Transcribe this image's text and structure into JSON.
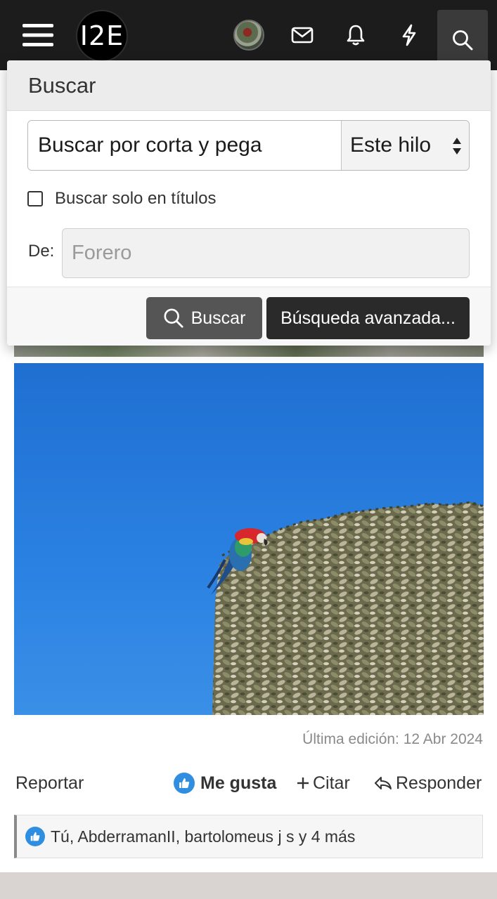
{
  "header": {
    "logo_text": "I2E",
    "icons": [
      "menu-icon",
      "avatar",
      "mail-icon",
      "bell-icon",
      "bolt-icon",
      "search-icon"
    ]
  },
  "search_panel": {
    "title": "Buscar",
    "query_value": "Buscar por corta y pega",
    "scope_selected": "Este hilo",
    "titles_only_label": "Buscar solo en títulos",
    "titles_only_checked": false,
    "from_label": "De:",
    "from_placeholder": "Forero",
    "search_button_label": "Buscar",
    "advanced_button_label": "Búsqueda avanzada..."
  },
  "post": {
    "last_edit": "Última edición: 12 Abr 2024",
    "actions": {
      "report": "Reportar",
      "like": "Me gusta",
      "quote": "Citar",
      "reply": "Responder"
    },
    "reactions_text": "Tú, AbderramanII, bartolomeus j s y 4 más"
  },
  "colors": {
    "topbar": "#1c1c1c",
    "like_blue": "#2f8ee0",
    "sky": "#2b82e2"
  }
}
